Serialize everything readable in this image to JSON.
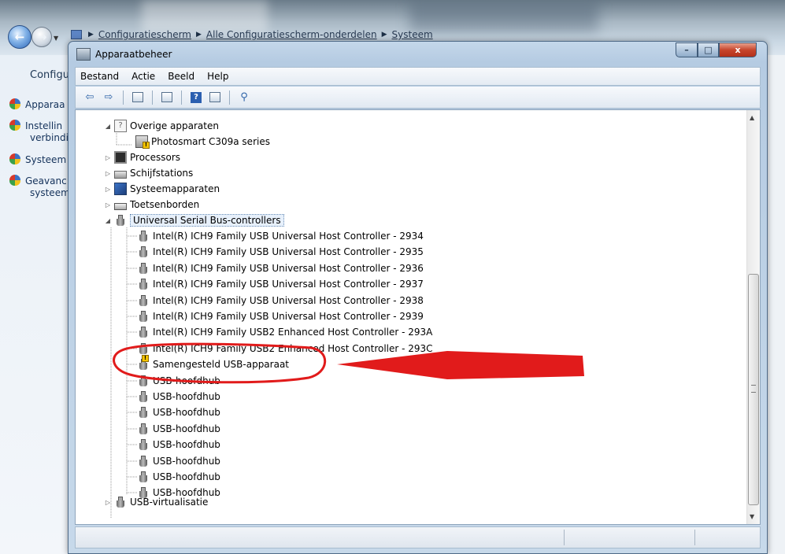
{
  "explorer": {
    "breadcrumb": [
      "Configuratiescherm",
      "Alle Configuratiescherm-onderdelen",
      "Systeem"
    ],
    "sidebar_title": "Configu",
    "sidebar_links": [
      {
        "lines": [
          "Apparaa"
        ]
      },
      {
        "lines": [
          "Instellin",
          "verbindi"
        ]
      },
      {
        "lines": [
          "Systeem"
        ]
      },
      {
        "lines": [
          "Geavanc",
          "systeem"
        ]
      }
    ]
  },
  "window": {
    "title": "Apparaatbeheer",
    "controls": {
      "minimize": "–",
      "maximize": "□",
      "close": "x"
    }
  },
  "menu": [
    "Bestand",
    "Actie",
    "Beeld",
    "Help"
  ],
  "toolbar_icons": [
    "back-arrow-icon",
    "forward-arrow-icon",
    "properties-icon",
    "view-icon",
    "help-icon",
    "monitor-icon",
    "scan-hardware-icon"
  ],
  "tree": {
    "overige": "Overige apparaten",
    "photosmart": "Photosmart C309a series",
    "processors": "Processors",
    "schijf": "Schijfstations",
    "systeem": "Systeemapparaten",
    "toets": "Toetsenborden",
    "usb_controllers": "Universal Serial Bus-controllers",
    "usb_children": [
      "Intel(R) ICH9 Family USB Universal Host Controller - 2934",
      "Intel(R) ICH9 Family USB Universal Host Controller - 2935",
      "Intel(R) ICH9 Family USB Universal Host Controller - 2936",
      "Intel(R) ICH9 Family USB Universal Host Controller - 2937",
      "Intel(R) ICH9 Family USB Universal Host Controller - 2938",
      "Intel(R) ICH9 Family USB Universal Host Controller - 2939",
      "Intel(R) ICH9 Family USB2 Enhanced Host Controller - 293A",
      "Intel(R) ICH9 Family USB2 Enhanced Host Controller - 293C",
      "Samengesteld USB-apparaat",
      "USB-hoofdhub",
      "USB-hoofdhub",
      "USB-hoofdhub",
      "USB-hoofdhub",
      "USB-hoofdhub",
      "USB-hoofdhub",
      "USB-hoofdhub",
      "USB-hoofdhub"
    ],
    "usb_virt": "USB-virtualisatie"
  },
  "colors": {
    "annotation": "#e11b1b",
    "selection_border": "#6c8fb7"
  }
}
